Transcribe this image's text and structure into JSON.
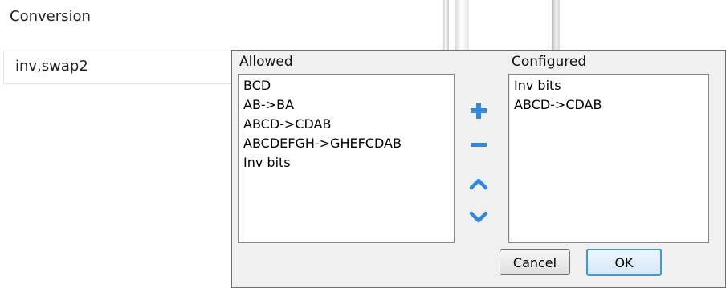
{
  "section": {
    "label": "Conversion"
  },
  "conversion_field": {
    "value": "inv,swap2"
  },
  "dialog": {
    "allowed_label": "Allowed",
    "configured_label": "Configured",
    "allowed_items": [
      "BCD",
      "AB->BA",
      "ABCD->CDAB",
      "ABCDEFGH->GHEFCDAB",
      "Inv bits"
    ],
    "configured_items": [
      "Inv bits",
      "ABCD->CDAB"
    ],
    "buttons": {
      "cancel": "Cancel",
      "ok": "OK"
    },
    "icons": {
      "add": "plus-icon",
      "remove": "minus-icon",
      "move_up": "chevron-up-icon",
      "move_down": "chevron-down-icon"
    }
  },
  "colors": {
    "accent": "#2f88e2",
    "ok_border": "#3c97e0"
  }
}
